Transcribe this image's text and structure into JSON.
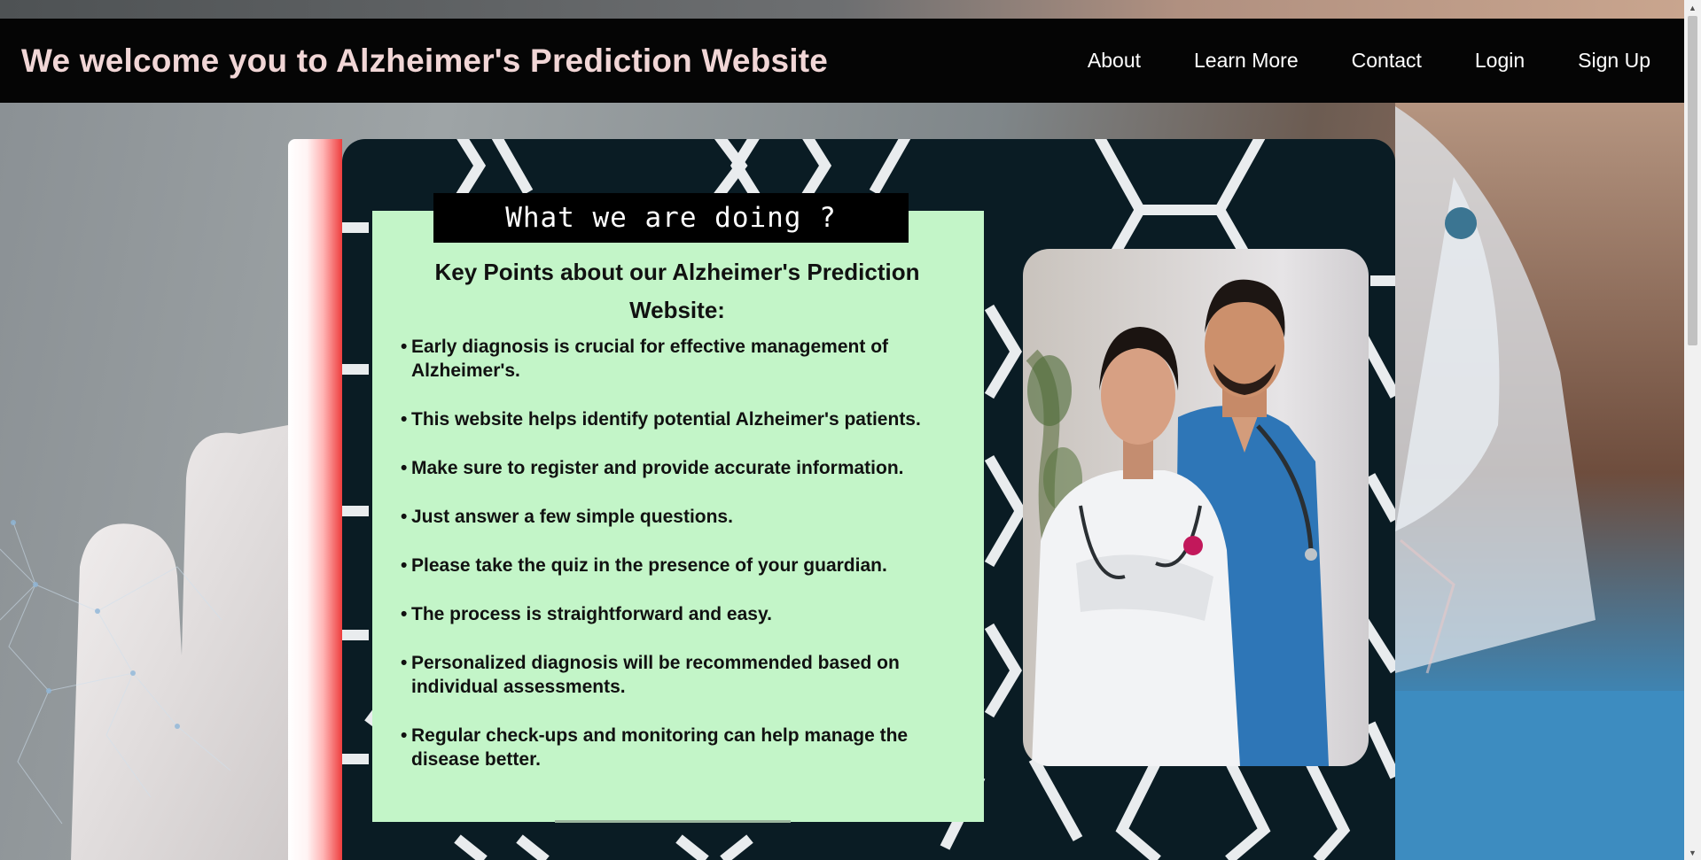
{
  "header": {
    "title": "We welcome you to Alzheimer's Prediction Website",
    "nav": [
      {
        "label": "About"
      },
      {
        "label": "Learn More"
      },
      {
        "label": "Contact"
      },
      {
        "label": "Login"
      },
      {
        "label": "Sign Up"
      }
    ]
  },
  "main": {
    "section_heading": "What we are doing ?",
    "panel_title": "Key Points about our Alzheimer's Prediction Website:",
    "points": [
      {
        "text": "Early diagnosis is crucial for effective management of Alzheimer's."
      },
      {
        "text": "This website helps identify potential Alzheimer's patients."
      },
      {
        "text": "Make sure to register and provide accurate information."
      },
      {
        "text": "Just answer a few simple questions."
      },
      {
        "text": "Please take the quiz in the presence of your guardian."
      },
      {
        "text": "The process is straightforward and easy."
      },
      {
        "text": "Personalized diagnosis will be recommended based on individual assessments."
      },
      {
        "text": "Regular check-ups and monitoring can help manage the disease better."
      }
    ],
    "bullet_glyph": "•"
  },
  "colors": {
    "navbar": "#050505",
    "title": "#f1d6d6",
    "panel": "#c3f5c8",
    "card": "#0a1c24",
    "accent_red": "#ee3d3d"
  },
  "icons": {
    "scroll_up": "▲",
    "scroll_down": "▼"
  }
}
